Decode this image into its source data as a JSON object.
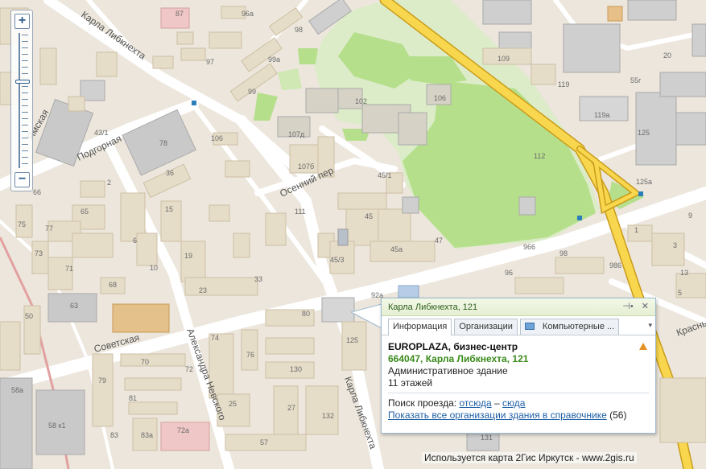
{
  "map": {
    "streets": [
      "Карла Либкнехта",
      "Ямская",
      "Подгорная",
      "Осенний пер",
      "Советская",
      "Александра Невского",
      "Карла Либкнехта",
      "Красны"
    ],
    "buildings": [
      "87",
      "96а",
      "98",
      "99а",
      "97",
      "99",
      "109",
      "20",
      "55г",
      "119",
      "119а",
      "125",
      "102",
      "106",
      "107д",
      "107б",
      "43/1",
      "78",
      "106",
      "36",
      "112",
      "45/1",
      "45",
      "47",
      "45а",
      "45/3",
      "111",
      "966",
      "98",
      "986",
      "96",
      "125а",
      "1",
      "3",
      "5",
      "66",
      "2",
      "75",
      "77",
      "65",
      "73",
      "6",
      "71",
      "10",
      "15",
      "19",
      "23",
      "33",
      "68",
      "63",
      "50",
      "92а",
      "80",
      "74",
      "76",
      "70",
      "72",
      "79",
      "81",
      "83",
      "83а",
      "130",
      "27",
      "25",
      "132",
      "125",
      "72а",
      "57",
      "58а",
      "58 к1",
      "131",
      "11",
      "13",
      "9"
    ]
  },
  "zoom": {
    "plus": "+",
    "minus": "−"
  },
  "popup": {
    "header": "Карла Либкнехта, 121",
    "ctrl_pin": "⊣•",
    "ctrl_close": "✕",
    "tabs": [
      "Информация",
      "Организации",
      "Компьютерные ..."
    ],
    "tab_more": "▾",
    "name": "EUROPLAZA, бизнес-центр",
    "address": "664047, Карла Либкнехта, 121",
    "type": "Административное здание",
    "floors": "11 этажей",
    "route_label": "Поиск проезда:",
    "route_from": "отсюда",
    "route_dash": "–",
    "route_to": "сюда",
    "show_all": "Показать все организации здания в справочнике",
    "show_all_count": "(56)"
  },
  "footer": "Используется карта 2Гис Иркутск - www.2gis.ru",
  "colors": {
    "background": "#ece6dc",
    "park": "#b5e08a",
    "main_road": "#f7cf4a",
    "building": "#e6ddc9"
  }
}
